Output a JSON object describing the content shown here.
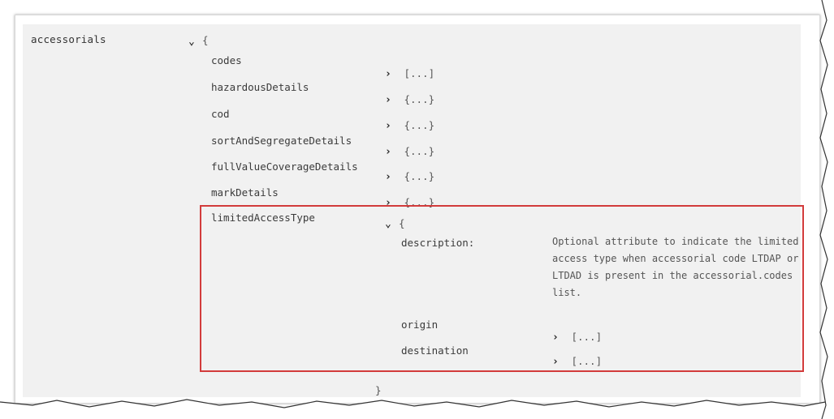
{
  "schema": {
    "root_label": "accessorials",
    "root_open": "{",
    "items": [
      {
        "name": "codes",
        "value": "[...]"
      },
      {
        "name": "hazardousDetails",
        "value": "{...}"
      },
      {
        "name": "cod",
        "value": "{...}"
      },
      {
        "name": "sortAndSegregateDetails",
        "value": "{...}"
      },
      {
        "name": "fullValueCoverageDetails",
        "value": "{...}"
      },
      {
        "name": "markDetails",
        "value": "{...}"
      }
    ],
    "limited": {
      "name": "limitedAccessType",
      "open": "{",
      "description_label": "description:",
      "description_text": "Optional attribute to indicate the limited access type when accessorial code LTDAP or LTDAD is present in the accessorial.codes list.",
      "origin_label": "origin",
      "origin_value": "[...]",
      "destination_label": "destination",
      "destination_value": "[...]"
    },
    "close": "}"
  },
  "colors": {
    "highlight": "#d23b3b",
    "background": "#f1f1f1"
  },
  "icons": {
    "expanded": "chevron-down-icon",
    "collapsed": "chevron-right-icon"
  }
}
